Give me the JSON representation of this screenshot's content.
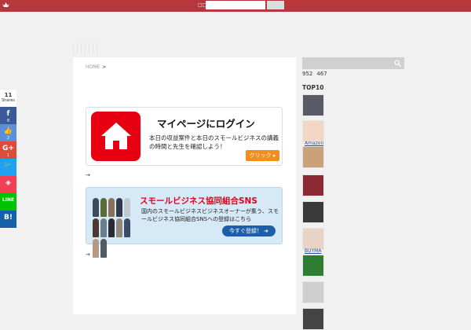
{
  "header": {
    "search_label": "□□□",
    "search_button": ""
  },
  "breadcrumb": {
    "home": "HOME",
    "separator": ">"
  },
  "banner_login": {
    "title": "マイページにログイン",
    "text": "本日の収益案件と本日のスモールビジネスの講義の時間と先生を確認しよう！",
    "button": "クリック ▸"
  },
  "banner_sns": {
    "title": "スモールビジネス協同組合SNS",
    "text": "国内のスモールビジネスビジネスオーナーが集う、スモールビジネス協同組合SNSへの登録はこちら",
    "button": "今すぐ登録！ ➜"
  },
  "arrows": {
    "first": "→",
    "second": "→"
  },
  "share": {
    "total": "11",
    "total_label": "Shares",
    "buttons": [
      {
        "icon": "f",
        "name": "facebook",
        "count": "8",
        "color": "#3b5998"
      },
      {
        "icon": "👍",
        "name": "like",
        "count": "2",
        "color": "#5b8fd6"
      },
      {
        "icon": "G+",
        "name": "google-plus",
        "count": "1",
        "color": "#dd4b39"
      },
      {
        "icon": "🐦",
        "name": "twitter",
        "count": "",
        "color": "#1da1f2"
      },
      {
        "icon": "◈",
        "name": "pocket",
        "count": "",
        "color": "#ef4056"
      },
      {
        "icon": "LINE",
        "name": "line",
        "count": "",
        "color": "#00c300"
      },
      {
        "icon": "B!",
        "name": "hatena",
        "count": "",
        "color": "#1460ab"
      }
    ]
  },
  "sidebar": {
    "count_a": "952",
    "count_b": "467",
    "top10_title": "TOP10",
    "ranking": [
      {
        "label": "",
        "avatar": "#5a5a66"
      },
      {
        "label": "Amazon",
        "avatar": "#f3d6c4"
      },
      {
        "label": "",
        "avatar": "#c9a27a"
      },
      {
        "label": "",
        "avatar": "#8b2a33"
      },
      {
        "label": "",
        "avatar": "#3a3a3a"
      },
      {
        "label": "BUYMA",
        "avatar": "#e9d3c4"
      },
      {
        "label": "",
        "avatar": "#2e7d32"
      },
      {
        "label": "",
        "avatar": "#cfcfcf"
      },
      {
        "label": "",
        "avatar": "#444444"
      },
      {
        "label": "",
        "avatar": "#2b2b2b"
      }
    ]
  }
}
